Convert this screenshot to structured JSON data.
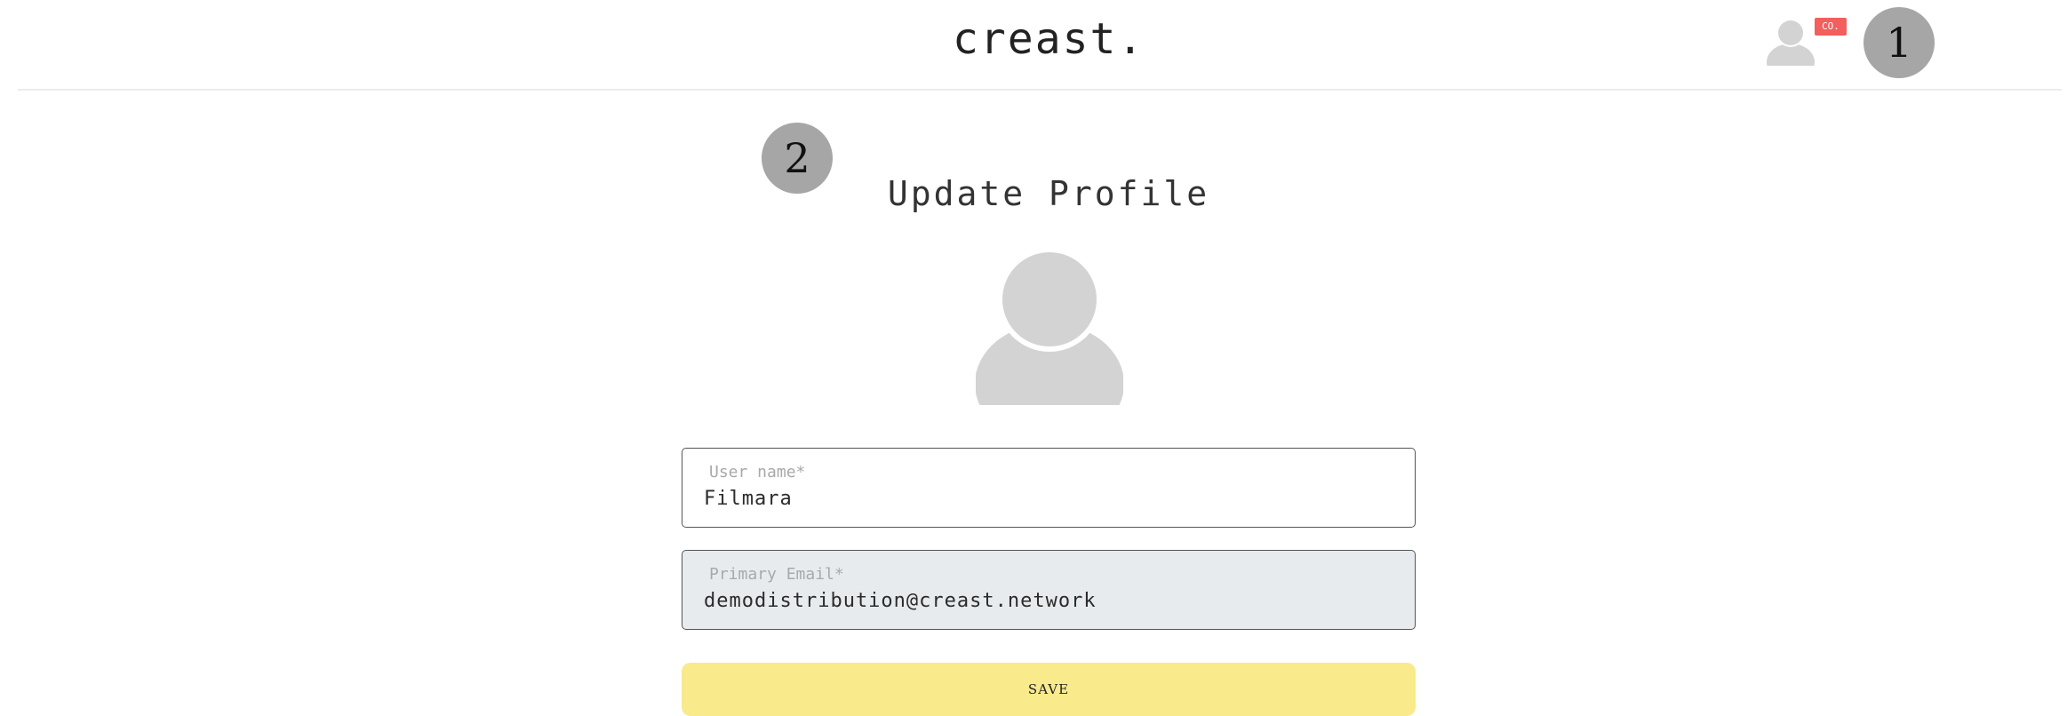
{
  "header": {
    "logo": "creast.",
    "user_badge": "CO."
  },
  "markers": {
    "step1": "1",
    "step2": "2"
  },
  "page": {
    "title": "Update Profile"
  },
  "form": {
    "username": {
      "label": "User name*",
      "value": "Filmara"
    },
    "email": {
      "label": "Primary Email*",
      "value": "demodistribution@creast.network"
    },
    "save_label": "SAVE"
  },
  "colors": {
    "accent_button": "#f9ea8c",
    "badge": "#f25f5c",
    "avatar_placeholder": "#d3d3d3",
    "disabled_field": "#e8ebee"
  },
  "icons": {
    "user_avatar": "user-silhouette-icon",
    "profile_avatar": "user-silhouette-icon"
  }
}
